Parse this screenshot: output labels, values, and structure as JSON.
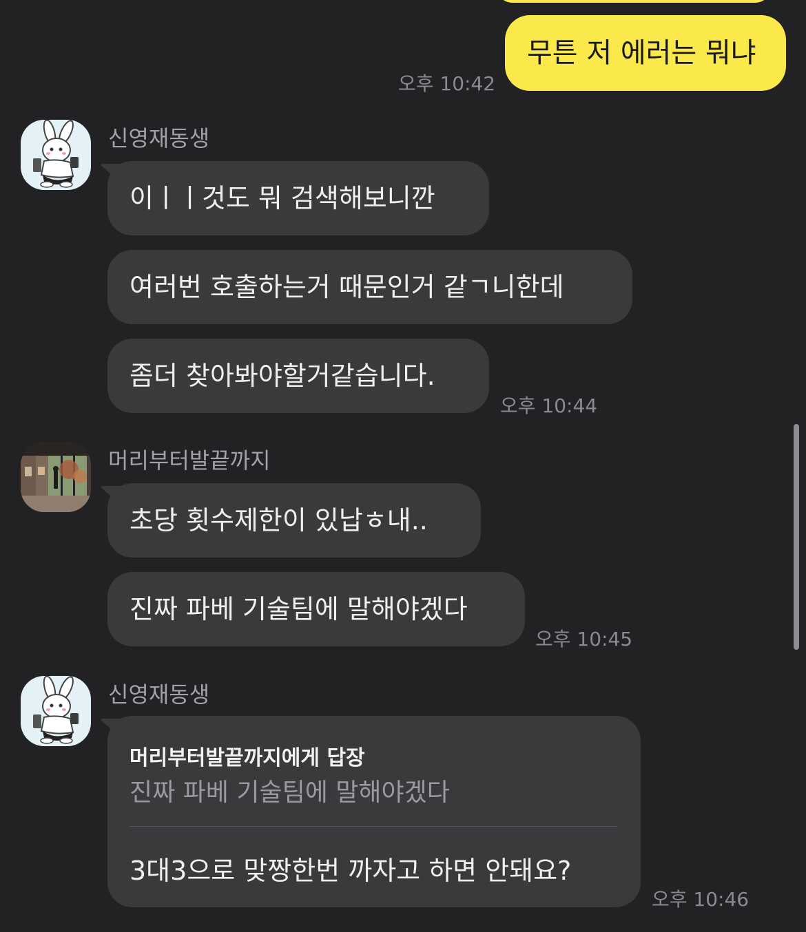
{
  "chat": {
    "top_outgoing": {
      "text": "무튼 저 에러는 뭐냐",
      "time": "오후 10:42"
    },
    "group1": {
      "sender": "신영재동생",
      "messages": [
        "이ㅣㅣ것도 뭐 검색해보니깐",
        "여러번 호출하는거 때문인거 같ㄱ니한데",
        "좀더 찾아봐야할거같습니다."
      ],
      "time": "오후 10:44"
    },
    "group2": {
      "sender": "머리부터발끝까지",
      "messages": [
        "초당 횟수제한이 있납ㅎ내..",
        "진짜 파베 기술팀에 말해야겠다"
      ],
      "time": "오후 10:45"
    },
    "group3": {
      "sender": "신영재동생",
      "reply_header": "머리부터발끝까지에게 답장",
      "reply_quote": "진짜 파베 기술팀에 말해야겠다",
      "message": "3대3으로 맞짱한번 까자고 하면 안돼요?",
      "time": "오후 10:46"
    }
  },
  "colors": {
    "background": "#222224",
    "outgoing_bubble": "#fbe84a",
    "incoming_bubble": "#3a3a3c",
    "timestamp": "#8b8b8f"
  }
}
